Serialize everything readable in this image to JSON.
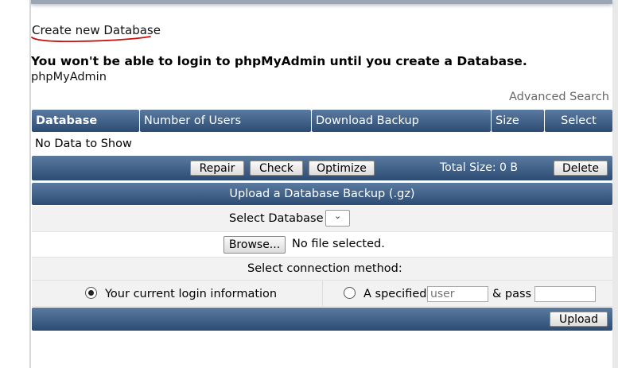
{
  "create_link": "Create new Database",
  "warning": "You won't be able to login to phpMyAdmin until you create a Database.",
  "phpmyadmin_link": "phpMyAdmin",
  "advanced_search": "Advanced Search",
  "table": {
    "headers": [
      "Database",
      "Number of Users",
      "Download Backup",
      "Size",
      "Select"
    ],
    "empty_text": "No Data to Show"
  },
  "actions": {
    "repair": "Repair",
    "check": "Check",
    "optimize": "Optimize",
    "total_size": "Total Size: 0 B",
    "delete": "Delete"
  },
  "upload": {
    "title": "Upload a Database Backup (.gz)",
    "select_database_label": "Select Database",
    "select_database_value": "",
    "browse_label": "Browse...",
    "no_file": "No file selected.",
    "connection_label": "Select connection method:",
    "option_current": "Your current login information",
    "option_specified": "A specified",
    "user_placeholder": "user",
    "pass_label": "& pass",
    "pass_placeholder": "",
    "upload_button": "Upload"
  },
  "colors": {
    "header_top": "#5a7aa0",
    "header_bottom": "#2c4c73",
    "row_alt": "#f2f2f2",
    "annotation_red": "#cc1111"
  }
}
